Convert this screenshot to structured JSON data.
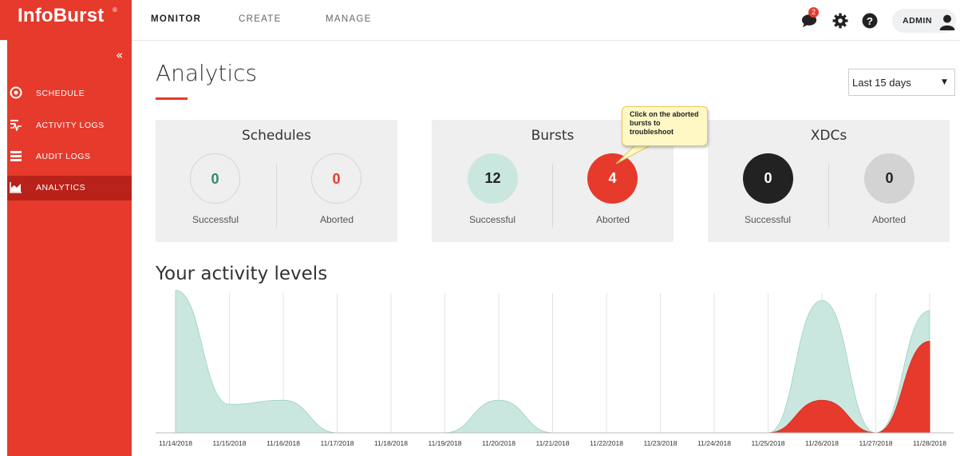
{
  "app": {
    "logo": "InfoBurst",
    "logo_mark": "®"
  },
  "topnav": {
    "items": [
      "MONITOR",
      "CREATE",
      "MANAGE"
    ],
    "active": "MONITOR",
    "notification_count": "2",
    "user": "ADMIN"
  },
  "sidebar": {
    "collapse_glyph": "«",
    "items": [
      {
        "label": "SCHEDULE",
        "icon": "target-icon"
      },
      {
        "label": "ACTIVITY LOGS",
        "icon": "activity-icon"
      },
      {
        "label": "AUDIT LOGS",
        "icon": "list-icon"
      },
      {
        "label": "ANALYTICS",
        "icon": "area-chart-icon",
        "active": true
      }
    ]
  },
  "page": {
    "title": "Analytics",
    "date_range": "Last 15 days"
  },
  "cards": [
    {
      "title": "Schedules",
      "successful": "0",
      "aborted": "0",
      "successful_label": "Successful",
      "aborted_label": "Aborted"
    },
    {
      "title": "Bursts",
      "successful": "12",
      "aborted": "4",
      "successful_label": "Successful",
      "aborted_label": "Aborted"
    },
    {
      "title": "XDCs",
      "successful": "0",
      "aborted": "0",
      "successful_label": "Successful",
      "aborted_label": "Aborted"
    }
  ],
  "tooltip": {
    "text": "Click on the aborted bursts to troubleshoot"
  },
  "activity": {
    "title": "Your activity levels"
  },
  "colors": {
    "brand": "#e53a2c",
    "brand_dark": "#b8221a",
    "successful": "#c9e7df",
    "aborted": "#e53a2c",
    "xdc_success": "#222222",
    "xdc_aborted": "#d3d3d3"
  },
  "chart_data": {
    "type": "area",
    "x": [
      "11/14/2018",
      "11/15/2018",
      "11/16/2018",
      "11/17/2018",
      "11/18/2018",
      "11/19/2018",
      "11/20/2018",
      "11/21/2018",
      "11/22/2018",
      "11/23/2018",
      "11/24/2018",
      "11/25/2018",
      "11/26/2018",
      "11/27/2018",
      "11/28/2018"
    ],
    "series": [
      {
        "values": [
          7,
          1.4,
          1.6,
          0,
          0,
          0,
          1.6,
          0,
          0,
          0,
          0,
          0,
          6.5,
          0,
          6
        ],
        "color": "#c9e7df"
      },
      {
        "values": [
          0,
          0,
          0,
          0,
          0,
          0,
          0,
          0,
          0,
          0,
          0,
          0,
          1.6,
          0,
          4.5
        ],
        "color": "#e53a2c"
      }
    ],
    "grid": true,
    "legend": "none"
  }
}
